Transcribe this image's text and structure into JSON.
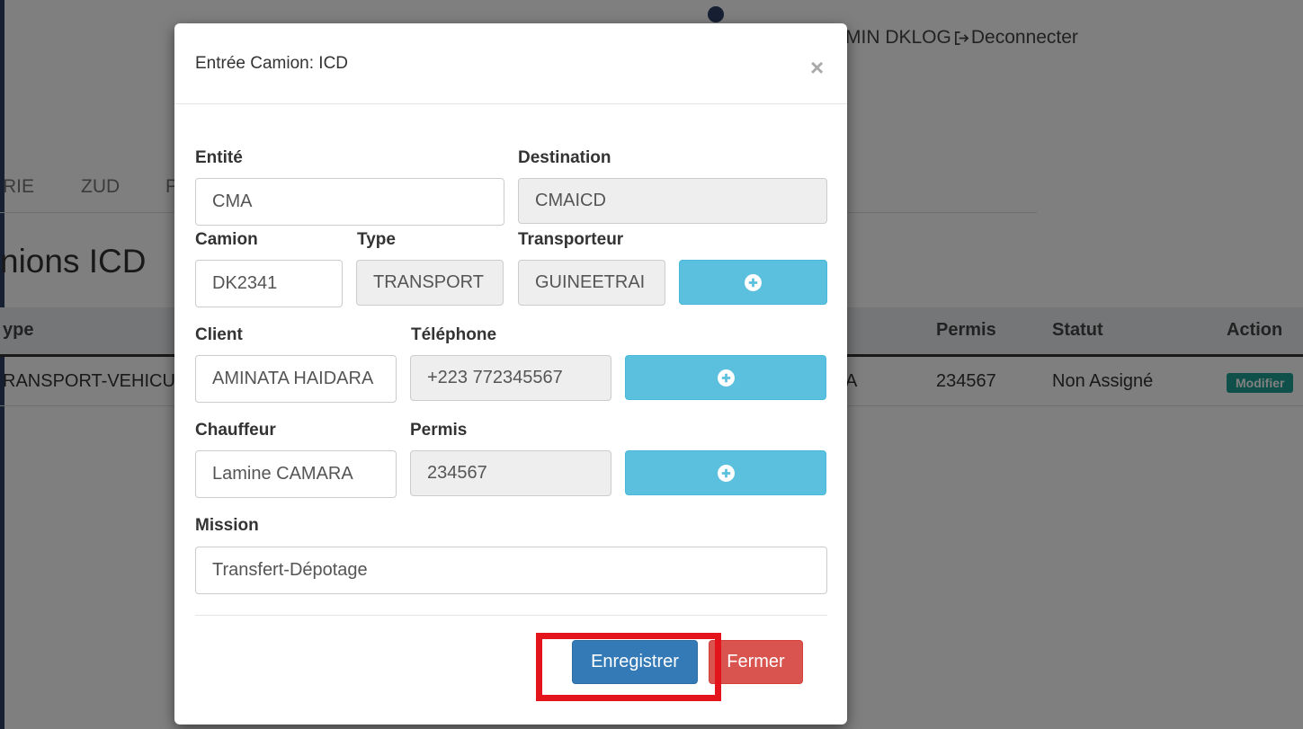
{
  "background": {
    "user": {
      "name": "MIN DKLOG",
      "logout_label": "Deconnecter"
    },
    "nav_tabs": [
      "RIE",
      "ZUD",
      "P"
    ],
    "page_title": "nions ICD",
    "table": {
      "headers": {
        "type": "ype",
        "permis": "Permis",
        "statut": "Statut",
        "action": "Action"
      },
      "row": {
        "type": "RANSPORT-VEHICU",
        "hidden_fragment": "A",
        "permis": "234567",
        "statut": "Non Assigné",
        "action_label": "Modifier"
      }
    }
  },
  "modal": {
    "title": "Entrée Camion: ICD",
    "close_symbol": "×",
    "fields": {
      "entite": {
        "label": "Entité",
        "value": "CMA"
      },
      "destination": {
        "label": "Destination",
        "value": "CMAICD"
      },
      "camion": {
        "label": "Camion",
        "value": "DK2341"
      },
      "type": {
        "label": "Type",
        "value": "TRANSPORT"
      },
      "transporteur": {
        "label": "Transporteur",
        "value": "GUINEETRAI"
      },
      "client": {
        "label": "Client",
        "value": "AMINATA HAIDARA"
      },
      "telephone": {
        "label": "Téléphone",
        "value": "+223 772345567"
      },
      "chauffeur": {
        "label": "Chauffeur",
        "value": "Lamine CAMARA"
      },
      "permis": {
        "label": "Permis",
        "value": "234567"
      },
      "mission": {
        "label": "Mission",
        "value": "Transfert-Dépotage"
      }
    },
    "footer": {
      "save_label": "Enregistrer",
      "close_label": "Fermer"
    }
  },
  "colors": {
    "primary": "#337ab7",
    "info": "#5bc0de",
    "danger": "#d9534f",
    "badge": "#1fa394",
    "highlight": "#e3141c"
  },
  "icons": {
    "add": "plus-circle-icon",
    "logout": "sign-out-icon",
    "close": "close-icon"
  }
}
